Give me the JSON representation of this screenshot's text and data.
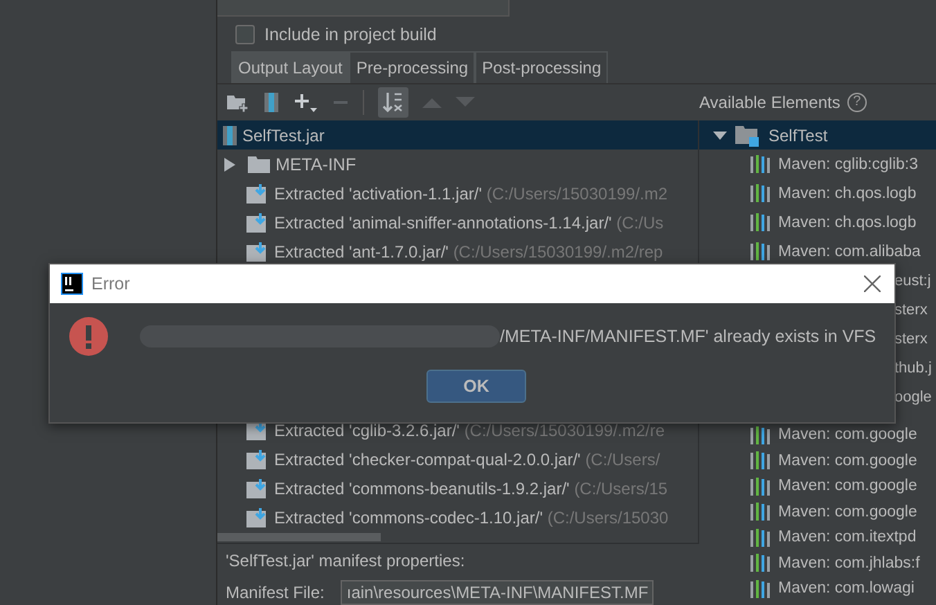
{
  "include_in_build": {
    "label": "Include in project build",
    "checked": false
  },
  "tabs": [
    {
      "label": "Output Layout",
      "selected": true
    },
    {
      "label": "Pre-processing",
      "selected": false
    },
    {
      "label": "Post-processing",
      "selected": false
    }
  ],
  "available_elements": {
    "title": "Available Elements",
    "help": "?"
  },
  "output_tree": {
    "root": {
      "name": "SelfTest.jar",
      "selected": true
    },
    "rows_above": [
      {
        "kind": "folder",
        "name": "META-INF",
        "expanded": false
      },
      {
        "kind": "extracted",
        "name": "Extracted 'activation-1.1.jar/'",
        "path": "(C:/Users/15030199/.m2"
      },
      {
        "kind": "extracted",
        "name": "Extracted 'animal-sniffer-annotations-1.14.jar/'",
        "path": "(C:/Us"
      },
      {
        "kind": "extracted",
        "name": "Extracted 'ant-1.7.0.jar/'",
        "path": "(C:/Users/15030199/.m2/rep"
      }
    ],
    "rows_below": [
      {
        "kind": "extracted",
        "name": "Extracted 'cglib-3.2.6.jar/'",
        "path": "(C:/Users/15030199/.m2/re"
      },
      {
        "kind": "extracted",
        "name": "Extracted 'checker-compat-qual-2.0.0.jar/'",
        "path": "(C:/Users/"
      },
      {
        "kind": "extracted",
        "name": "Extracted 'commons-beanutils-1.9.2.jar/'",
        "path": "(C:/Users/15"
      },
      {
        "kind": "extracted",
        "name": "Extracted 'commons-codec-1.10.jar/'",
        "path": "(C:/Users/15030"
      }
    ]
  },
  "elements_tree": {
    "root": {
      "name": "SelfTest",
      "selected": true
    },
    "expanded": true,
    "rows": [
      {
        "kind": "library",
        "text": "Maven: cglib:cglib:3"
      },
      {
        "kind": "library",
        "text": "Maven: ch.qos.logb"
      },
      {
        "kind": "library",
        "text": "Maven: ch.qos.logb"
      },
      {
        "kind": "library",
        "text": "Maven: com.alibaba"
      },
      {
        "kind": "fragment",
        "text": "eust:j"
      },
      {
        "kind": "fragment",
        "text": "sterx"
      },
      {
        "kind": "fragment",
        "text": "sterx"
      },
      {
        "kind": "fragment",
        "text": "thub.j"
      },
      {
        "kind": "fragment",
        "text": "oogle"
      },
      {
        "kind": "library",
        "text": "Maven: com.google"
      },
      {
        "kind": "library",
        "text": "Maven: com.google"
      },
      {
        "kind": "library",
        "text": "Maven: com.google"
      },
      {
        "kind": "library",
        "text": "Maven: com.google"
      },
      {
        "kind": "library",
        "text": "Maven: com.itextpd"
      },
      {
        "kind": "library",
        "text": "Maven: com.jhlabs:f"
      },
      {
        "kind": "library",
        "text": "Maven: com.lowagi"
      }
    ]
  },
  "manifest": {
    "heading": "'SelfTest.jar' manifest properties:",
    "file_label": "Manifest File:",
    "file_value": "ıain\\resources\\META-INF\\MANIFEST.MF"
  },
  "dialog": {
    "title": "Error",
    "message": "/META-INF/MANIFEST.MF' already exists in VFS",
    "button": "OK"
  }
}
